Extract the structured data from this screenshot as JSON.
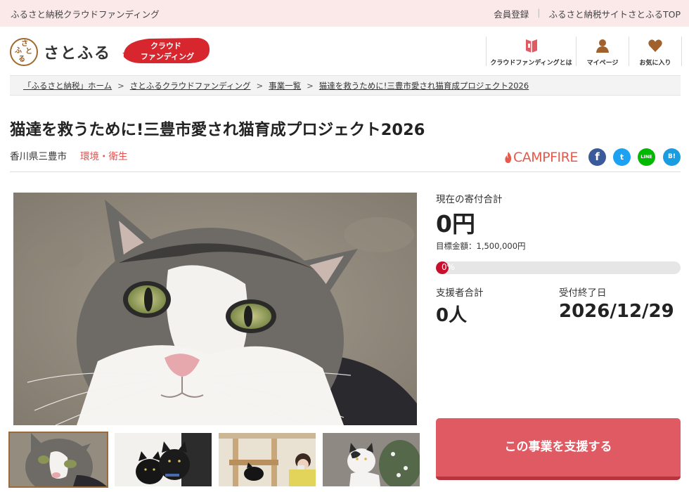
{
  "topbar": {
    "title": "ふるさと納税クラウドファンディング",
    "links": [
      "会員登録",
      "ふるさと納税サイトさとふるTOP"
    ]
  },
  "header": {
    "logo_seal_chars": [
      "さ",
      "と",
      "ふ",
      "る"
    ],
    "logo_text": "さとふる",
    "badge_line1": "クラウド",
    "badge_line2": "ファンディング",
    "nav": [
      {
        "label": "クラウドファンディングとは",
        "icon": "book-icon"
      },
      {
        "label": "マイページ",
        "icon": "person-icon"
      },
      {
        "label": "お気に入り",
        "icon": "heart-icon"
      }
    ]
  },
  "breadcrumb": [
    "「ふるさと納税」ホーム",
    "さとふるクラウドファンディング",
    "事業一覧",
    "猫達を救うために!三豊市愛され猫育成プロジェクト2026"
  ],
  "breadcrumb_sep": ">",
  "project": {
    "title": "猫達を救うために!三豊市愛され猫育成プロジェクト2026",
    "location": "香川県三豊市",
    "category": "環境・衛生"
  },
  "partner": {
    "name": "CAMPFIRE"
  },
  "share": {
    "facebook": "f",
    "twitter": "t",
    "line": "LINE",
    "hatena": "B!"
  },
  "stats": {
    "total_label": "現在の寄付合計",
    "total_value": "0円",
    "target_text": "目標金額：1,500,000円",
    "progress_text": "0%",
    "progress_percent": 0,
    "supporters_label": "支援者合計",
    "supporters_value": "0人",
    "deadline_label": "受付終了日",
    "deadline_value": "2026/12/29"
  },
  "cta": {
    "label": "この事業を支援する"
  },
  "colors": {
    "accent": "#e05a63",
    "topbar_bg": "#fbe9ea",
    "category": "#e0524f",
    "campfire": "#e65a4c"
  }
}
